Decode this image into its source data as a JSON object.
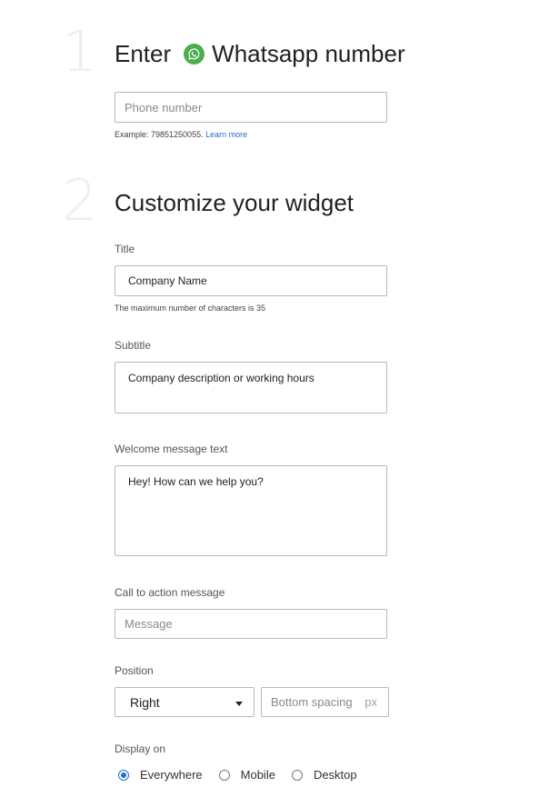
{
  "step1": {
    "number": "1",
    "heading_prefix": "Enter",
    "heading_suffix": "Whatsapp number",
    "phone_placeholder": "Phone number",
    "example_text": "Example: 79851250055.",
    "learn_more": "Learn more"
  },
  "step2": {
    "number": "2",
    "heading": "Customize your widget",
    "title_label": "Title",
    "title_value": "Company Name",
    "title_hint": "The maximum number of characters is 35",
    "subtitle_label": "Subtitle",
    "subtitle_value": "Company description or working hours",
    "welcome_label": "Welcome message text",
    "welcome_value": "Hey! How can we help you?",
    "cta_label": "Call to action message",
    "cta_placeholder": "Message",
    "position_label": "Position",
    "position_value": "Right",
    "bottom_spacing_placeholder": "Bottom spacing",
    "bottom_spacing_unit": "px",
    "display_label": "Display on",
    "display_options": [
      "Everywhere",
      "Mobile",
      "Desktop"
    ],
    "display_selected": "Everywhere"
  },
  "colors": {
    "whatsapp_green": "#4cae4f",
    "link_blue": "#1f6fc6",
    "radio_blue": "#1e6fd9",
    "step_number_gray": "#eeeeee"
  },
  "icons": {
    "whatsapp": "whatsapp-icon",
    "select_arrow": "caret-down-icon"
  }
}
